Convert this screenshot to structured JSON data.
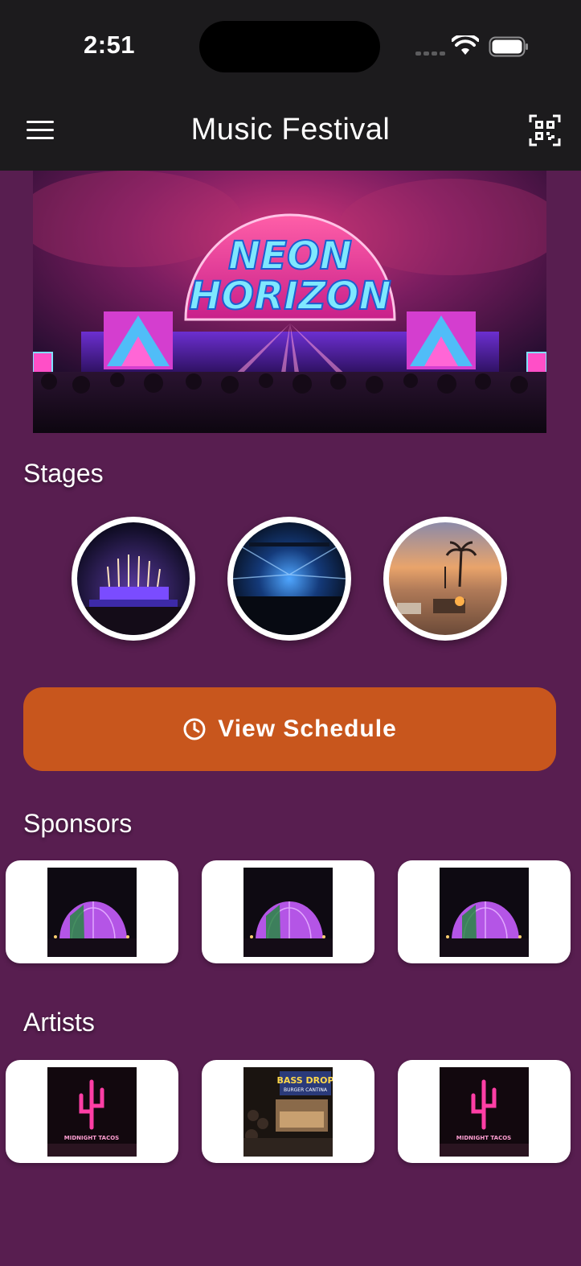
{
  "status_bar": {
    "time": "2:51"
  },
  "app_bar": {
    "title": "Music Festival",
    "menu_icon": "hamburger-menu-icon",
    "qr_icon": "qr-code-scan-icon"
  },
  "hero": {
    "banner_text_line1": "NEON",
    "banner_text_line2": "HORIZON"
  },
  "stages": {
    "title": "Stages",
    "items": [
      {
        "name": "stage-fireworks"
      },
      {
        "name": "stage-lights"
      },
      {
        "name": "stage-desert"
      }
    ]
  },
  "schedule_button": {
    "label": "View Schedule",
    "icon": "clock-icon"
  },
  "sponsors": {
    "title": "Sponsors"
  },
  "artists": {
    "title": "Artists",
    "cactus_sign": "MIDNIGHT TACOS",
    "food_stand_sign": "BASS DROP",
    "food_stand_sub": "BURGER CANTINA"
  },
  "colors": {
    "background": "#581e50",
    "app_bar": "#1c1b1d",
    "accent_button": "#c8561d",
    "card": "#ffffff"
  }
}
